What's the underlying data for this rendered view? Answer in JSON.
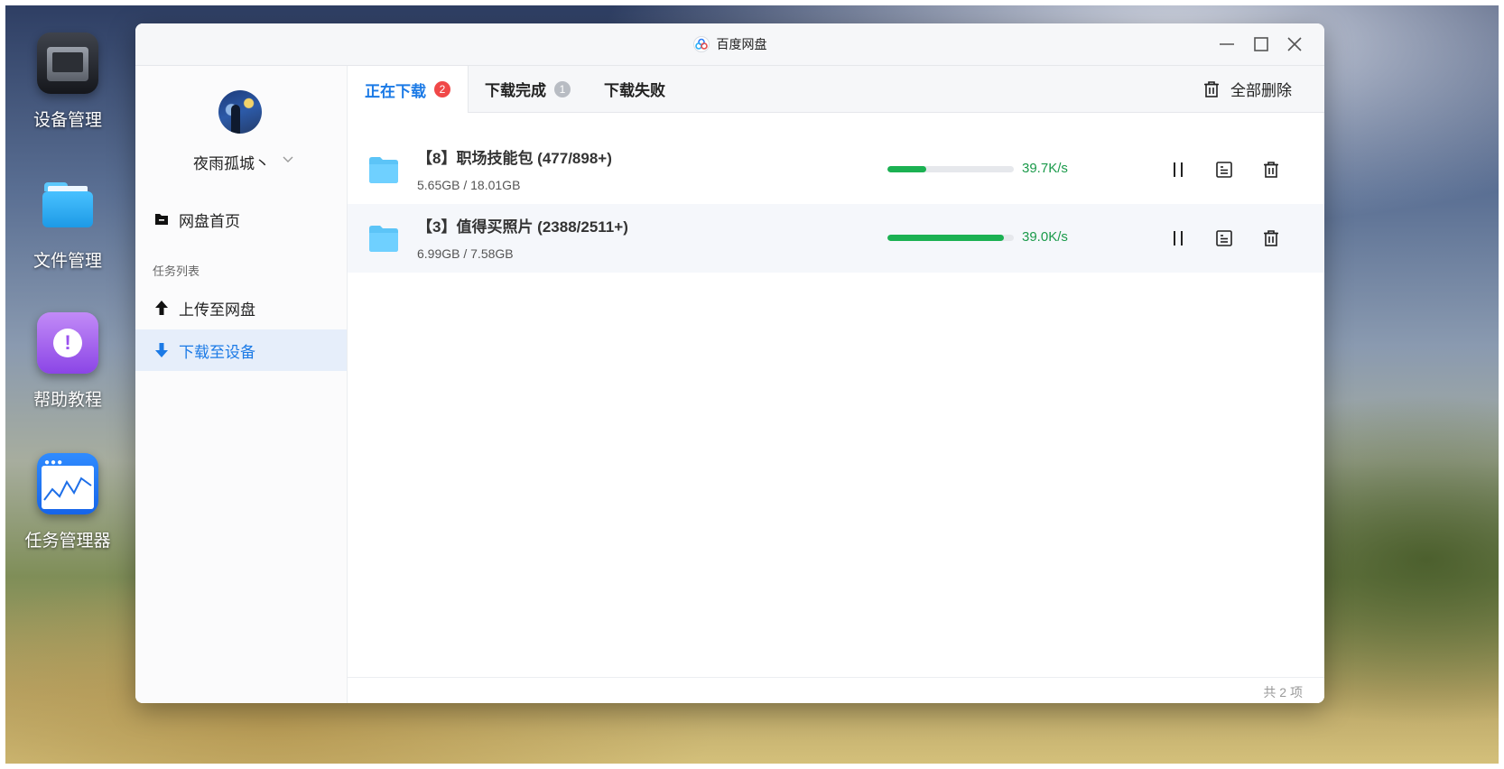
{
  "desktop": {
    "icons": [
      {
        "label": "设备管理",
        "icon": "storage-device-icon"
      },
      {
        "label": "文件管理",
        "icon": "folder-icon"
      },
      {
        "label": "帮助教程",
        "icon": "help-icon"
      },
      {
        "label": "任务管理器",
        "icon": "task-monitor-icon"
      }
    ]
  },
  "window": {
    "title": "百度网盘",
    "controls": [
      "minimize-icon",
      "maximize-icon",
      "close-icon"
    ]
  },
  "sidebar": {
    "username": "夜雨孤城丶",
    "nav_home": "网盘首页",
    "section_label": "任务列表",
    "nav_upload": "上传至网盘",
    "nav_download": "下载至设备",
    "active_item": "下载至设备"
  },
  "tabs": {
    "downloading": {
      "label": "正在下载",
      "badge": "2"
    },
    "completed": {
      "label": "下载完成",
      "badge": "1"
    },
    "failed": {
      "label": "下载失败"
    },
    "active": "正在下载"
  },
  "toolbar": {
    "delete_all": "全部删除"
  },
  "tasks": [
    {
      "name": "【8】职场技能包 (477/898+)",
      "size": "5.65GB / 18.01GB",
      "progress": 0.31,
      "speed": "39.7K/s"
    },
    {
      "name": "【3】值得买照片 (2388/2511+)",
      "size": "6.99GB / 7.58GB",
      "progress": 0.92,
      "speed": "39.0K/s"
    }
  ],
  "footer": {
    "count": "共 2 项"
  },
  "colors": {
    "accent": "#1b7ae6",
    "progress": "#1bb152",
    "speed_text": "#1a9a4a",
    "badge_red": "#f04848",
    "badge_gray": "#b8bcc3",
    "folder": "#5cc4f7"
  }
}
